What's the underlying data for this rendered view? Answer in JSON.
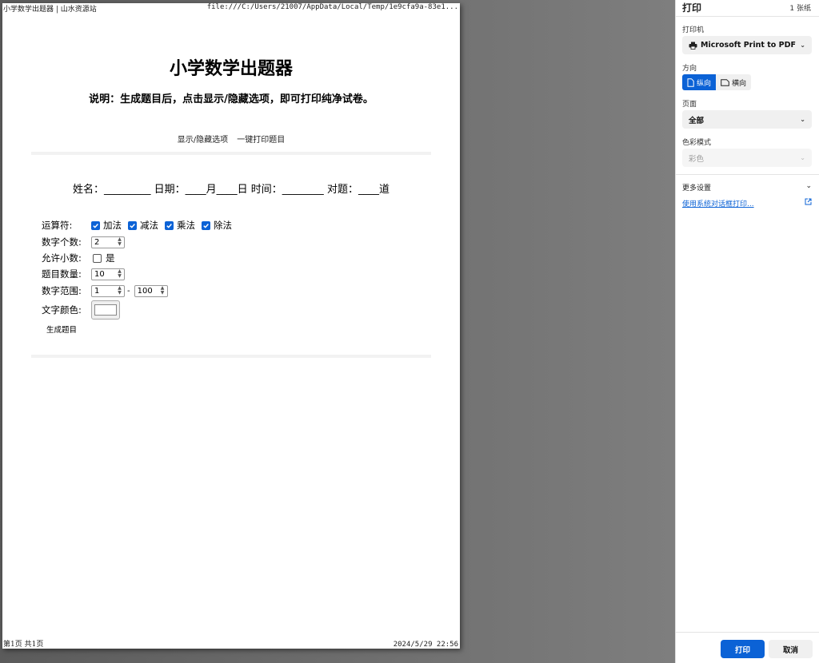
{
  "preview": {
    "header_left": "小学数学出题器 | 山水资源站",
    "header_right": "file:///C:/Users/21007/AppData/Local/Temp/1e9cfa9a-83e1...",
    "footer_left": "第1页 共1页",
    "footer_right": "2024/5/29 22:56"
  },
  "document": {
    "title": "小学数学出题器",
    "description": "说明：生成题目后，点击显示/隐藏选项，即可打印纯净试卷。",
    "toggle_link": "显示/隐藏选项",
    "print_link": "一键打印题目",
    "name_line": "姓名：_________ 日期：____月____日 时间：________ 对题：____道",
    "options": {
      "operators_label": "运算符:",
      "operators": [
        {
          "label": "加法",
          "checked": true
        },
        {
          "label": "减法",
          "checked": true
        },
        {
          "label": "乘法",
          "checked": true
        },
        {
          "label": "除法",
          "checked": true
        }
      ],
      "count_label": "数字个数:",
      "count_value": "2",
      "decimal_label": "允许小数:",
      "decimal_option": "是",
      "decimal_checked": false,
      "qty_label": "题目数量:",
      "qty_value": "10",
      "range_label": "数字范围:",
      "range_min": "1",
      "range_sep": "-",
      "range_max": "100",
      "color_label": "文字颜色:",
      "color_value": "#ffffff"
    },
    "generate_button": "生成题目"
  },
  "panel": {
    "title": "打印",
    "sheets": "1 张纸",
    "printer_label": "打印机",
    "printer_value": "Microsoft Print to PDF",
    "orientation_label": "方向",
    "orientation_portrait": "纵向",
    "orientation_landscape": "横向",
    "pages_label": "页面",
    "pages_value": "全部",
    "color_mode_label": "色彩模式",
    "color_mode_value": "彩色",
    "more_settings": "更多设置",
    "system_dialog": "使用系统对话框打印...",
    "print_button": "打印",
    "cancel_button": "取消",
    "accent_color": "#0b62d6"
  }
}
